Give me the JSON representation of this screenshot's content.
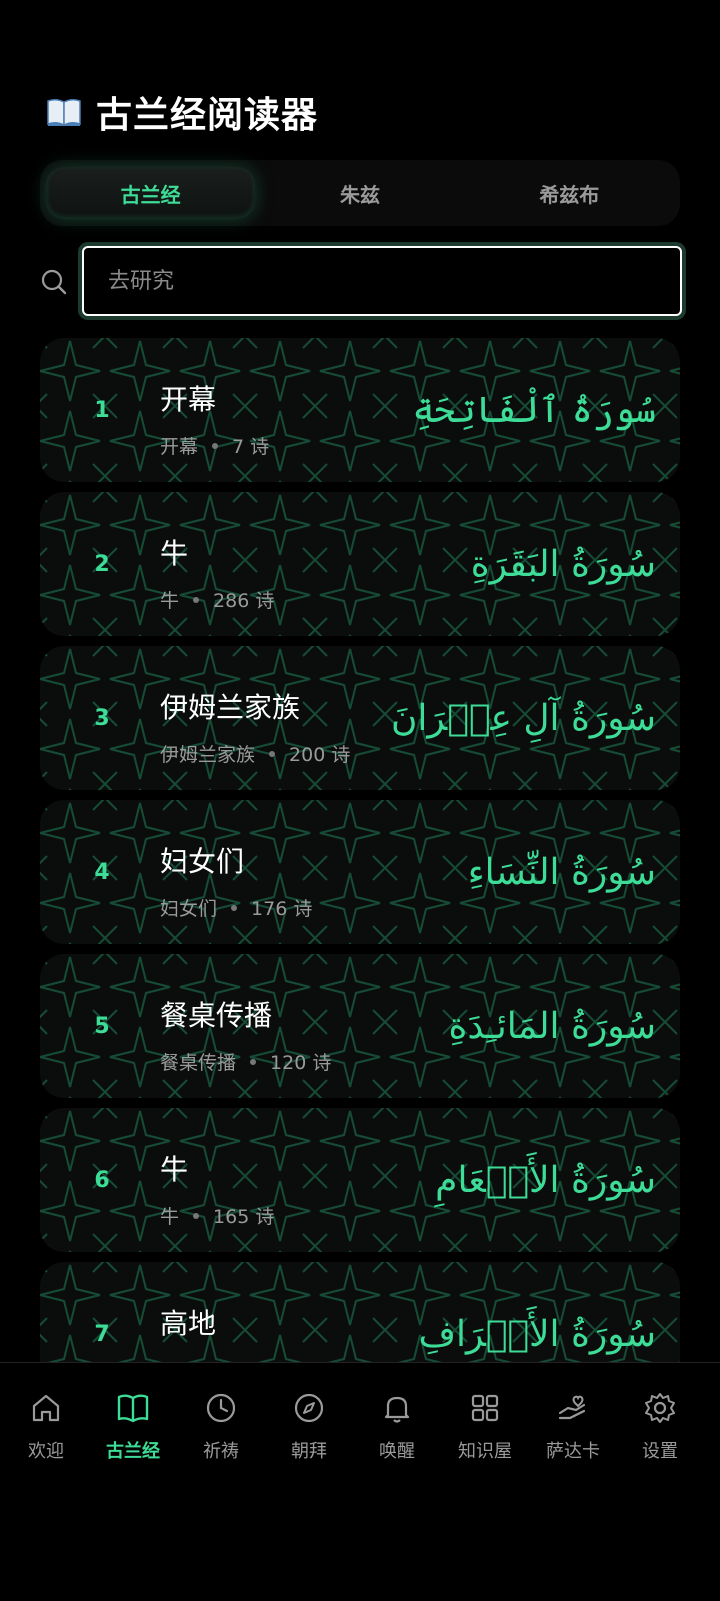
{
  "app": {
    "title": "古兰经阅读器",
    "icon": "open-book-icon"
  },
  "tabs": [
    {
      "label": "古兰经",
      "active": true
    },
    {
      "label": "朱兹",
      "active": false
    },
    {
      "label": "希兹布",
      "active": false
    }
  ],
  "search": {
    "placeholder": "去研究",
    "value": ""
  },
  "surahs": [
    {
      "number": "1",
      "name": "开幕",
      "subtitle": "开幕",
      "verses": "7 诗",
      "arabic": "سُورَةُ ٱلْفَاتِحَةِ"
    },
    {
      "number": "2",
      "name": "牛",
      "subtitle": "牛",
      "verses": "286 诗",
      "arabic": "سُورَةُ البَقَرَةِ"
    },
    {
      "number": "3",
      "name": "伊姆兰家族",
      "subtitle": "伊姆兰家族",
      "verses": "200 诗",
      "arabic": "سُورَةُ آلِ عِمۡرَانَ"
    },
    {
      "number": "4",
      "name": "妇女们",
      "subtitle": "妇女们",
      "verses": "176 诗",
      "arabic": "سُورَةُ النِّسَاءِ"
    },
    {
      "number": "5",
      "name": "餐桌传播",
      "subtitle": "餐桌传播",
      "verses": "120 诗",
      "arabic": "سُورَةُ المَائـِدَةِ"
    },
    {
      "number": "6",
      "name": "牛",
      "subtitle": "牛",
      "verses": "165 诗",
      "arabic": "سُورَةُ الأَنۡعَامِ"
    },
    {
      "number": "7",
      "name": "高地",
      "subtitle": "",
      "verses": "",
      "arabic": "سُورَةُ الأَعۡرَافِ"
    }
  ],
  "nav": [
    {
      "label": "欢迎",
      "icon": "home-icon",
      "active": false
    },
    {
      "label": "古兰经",
      "icon": "book-icon",
      "active": true
    },
    {
      "label": "祈祷",
      "icon": "clock-icon",
      "active": false
    },
    {
      "label": "朝拜",
      "icon": "compass-icon",
      "active": false
    },
    {
      "label": "唤醒",
      "icon": "bell-icon",
      "active": false
    },
    {
      "label": "知识屋",
      "icon": "grid-icon",
      "active": false
    },
    {
      "label": "萨达卡",
      "icon": "hand-heart-icon",
      "active": false
    },
    {
      "label": "设置",
      "icon": "gear-icon",
      "active": false
    }
  ],
  "colors": {
    "accent": "#3ddc97",
    "background": "#000000",
    "card": "#0b0d0c",
    "muted": "#9a9a9a"
  }
}
